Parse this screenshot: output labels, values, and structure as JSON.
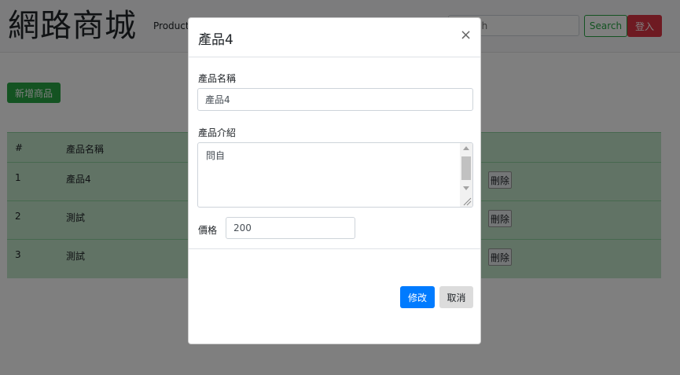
{
  "navbar": {
    "brand": "網路商城",
    "nav_link": "Products",
    "search_placeholder": "Search",
    "search_button": "Search",
    "login_button": "登入"
  },
  "main": {
    "add_button": "新增商品",
    "table": {
      "headers": [
        "#",
        "產品名稱"
      ],
      "rows": [
        {
          "num": "1",
          "name": "產品4",
          "delete_label": "刪除"
        },
        {
          "num": "2",
          "name": "測試",
          "delete_label": "刪除"
        },
        {
          "num": "3",
          "name": "測試",
          "delete_label": "刪除"
        }
      ]
    }
  },
  "modal": {
    "title": "產品4",
    "close_symbol": "×",
    "name_label": "產品名稱",
    "name_value": "產品4",
    "desc_label": "產品介紹",
    "desc_value": "問自",
    "price_label": "價格",
    "price_value": "200",
    "save_button": "修改",
    "cancel_button": "取消"
  }
}
